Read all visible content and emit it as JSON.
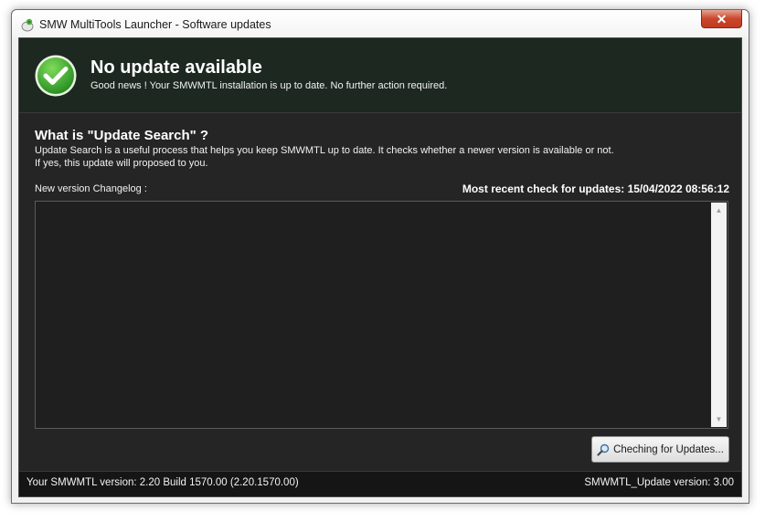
{
  "window": {
    "title": "SMW MultiTools Launcher - Software updates",
    "icons": {
      "app": "app-logo-icon",
      "close": "close-icon"
    }
  },
  "header": {
    "title": "No update available",
    "subtitle": "Good news ! Your SMWMTL installation is up to date. No further action required.",
    "status_icon": "check-circle-icon",
    "status_color": "#3aa832"
  },
  "info": {
    "title": "What is \"Update Search\" ?",
    "line1": "Update Search is a useful process that helps you keep SMWMTL up to date. It checks whether a newer version is available or not.",
    "line2": "If yes, this update will proposed to you."
  },
  "changelog": {
    "label": "New version Changelog :",
    "content": ""
  },
  "last_check": {
    "text": "Most recent check for updates: 15/04/2022 08:56:12"
  },
  "check_button": {
    "label": "Cheching for Updates...",
    "icon": "search-icon"
  },
  "footer": {
    "version": "Your SMWMTL version: 2.20 Build 1570.00 (2.20.1570.00)",
    "updater_version": "SMWMTL_Update version: 3.00"
  }
}
